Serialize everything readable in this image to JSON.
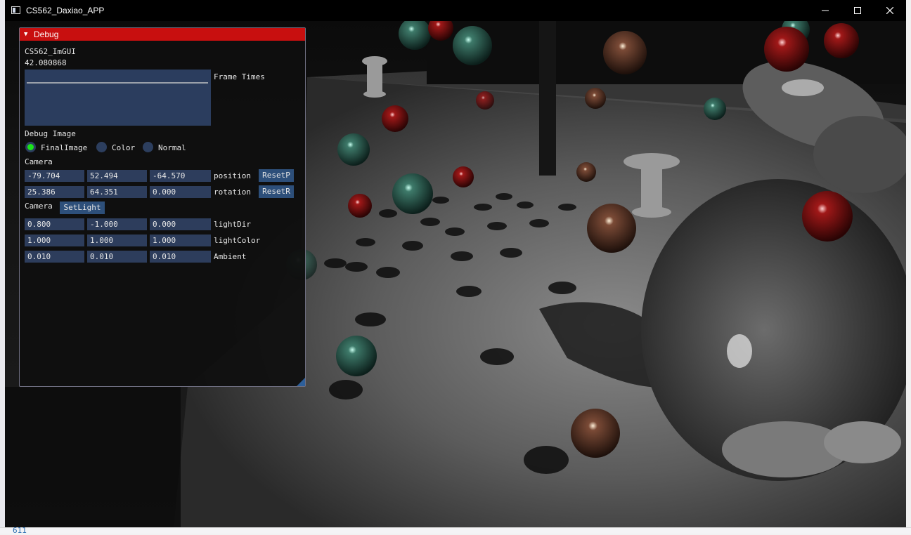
{
  "window": {
    "title": "CS562_Daxiao_APP"
  },
  "background_editor": {
    "line_number": "611"
  },
  "debug": {
    "title": "Debug",
    "app_label": "CS562_ImGUI",
    "fps_value": "42.080868",
    "frame_times_label": "Frame Times",
    "debug_image_label": "Debug Image",
    "debug_image_options": [
      "FinalImage",
      "Color",
      "Normal"
    ],
    "debug_image_selected": "FinalImage",
    "camera_label": "Camera",
    "position": {
      "values": [
        "-79.704",
        "52.494",
        "-64.570"
      ],
      "label": "position",
      "button": "ResetP"
    },
    "rotation": {
      "values": [
        "25.386",
        "64.351",
        "0.000"
      ],
      "label": "rotation",
      "button": "ResetR"
    },
    "camera_label_2": "Camera",
    "setlight_button": "SetLight",
    "light_dir": {
      "values": [
        "0.800",
        "-1.000",
        "0.000"
      ],
      "label": "lightDir"
    },
    "light_color": {
      "values": [
        "1.000",
        "1.000",
        "1.000"
      ],
      "label": "lightColor"
    },
    "ambient": {
      "values": [
        "0.010",
        "0.010",
        "0.010"
      ],
      "label": "Ambient"
    }
  },
  "colors": {
    "title_bar_active": "#c80f0f",
    "radio_selected": "#1be31b",
    "field_bg": "#2d3d5c",
    "button_bg": "#2d4f7a"
  }
}
